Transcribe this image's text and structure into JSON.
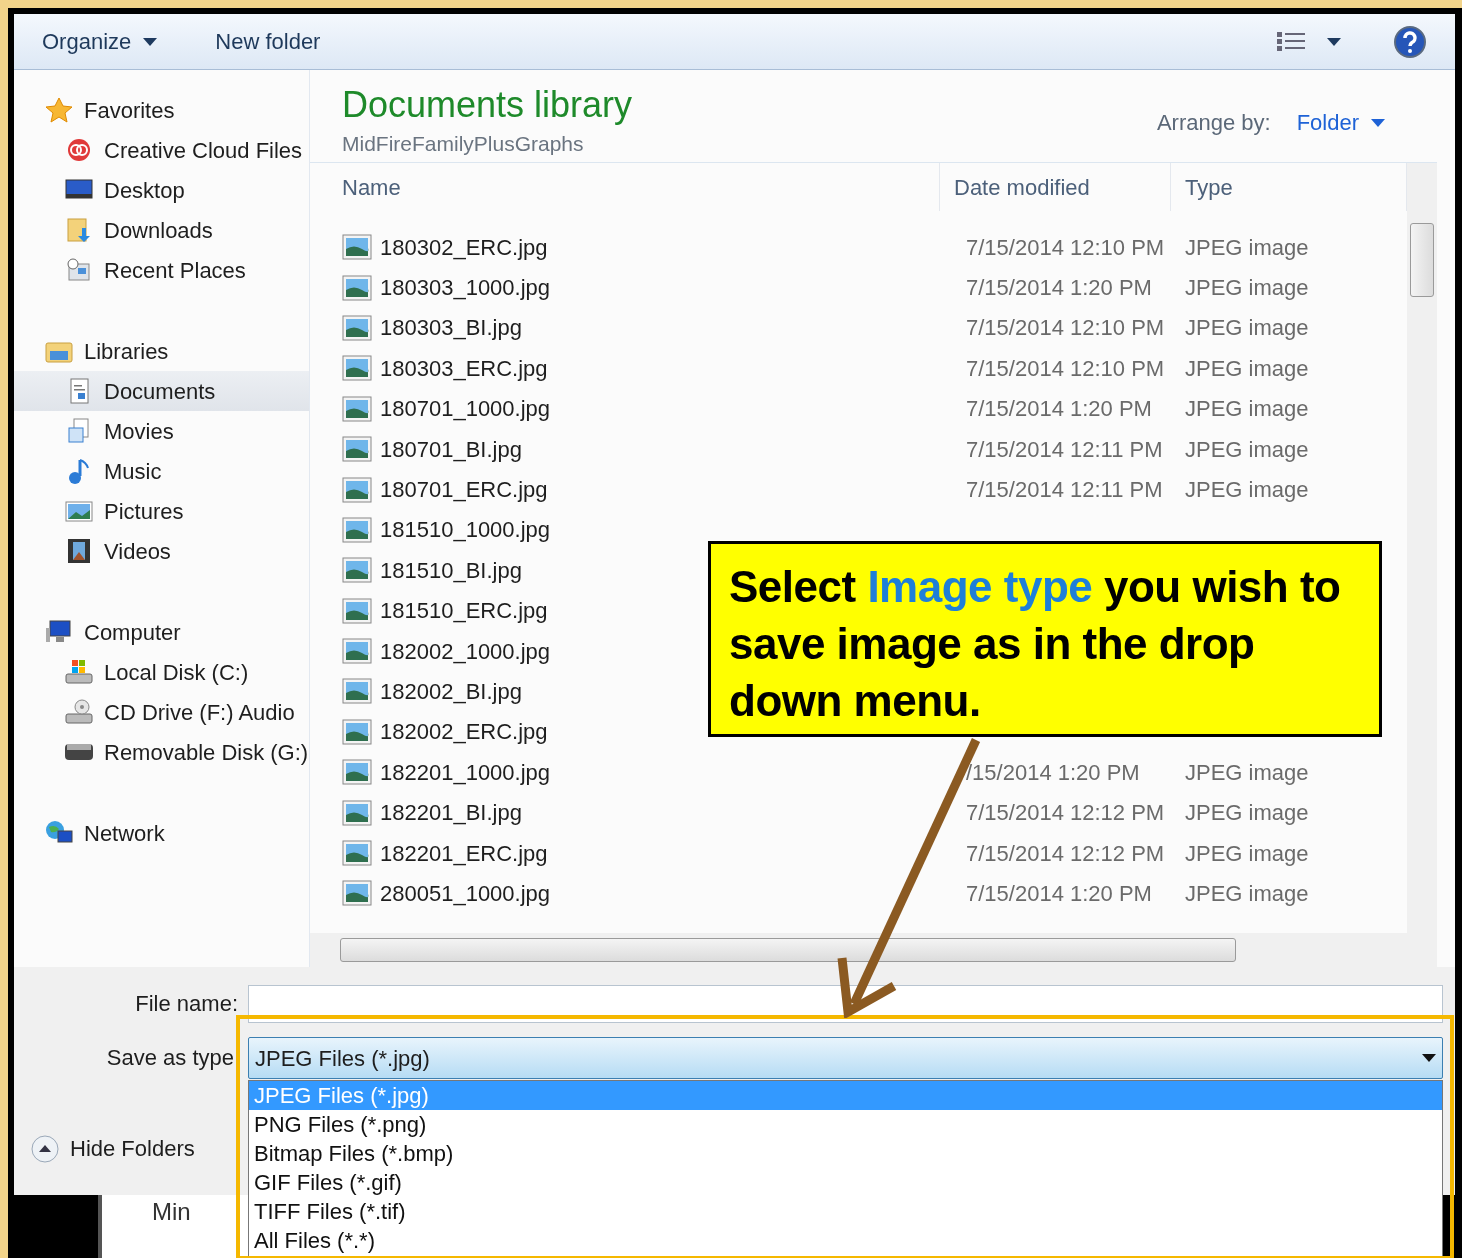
{
  "toolbar": {
    "organize": "Organize",
    "new_folder": "New folder"
  },
  "nav": [
    {
      "label": "Favorites",
      "children": [
        {
          "label": "Creative Cloud Files",
          "selected": false
        },
        {
          "label": "Desktop",
          "selected": false
        },
        {
          "label": "Downloads",
          "selected": false
        },
        {
          "label": "Recent Places",
          "selected": false
        }
      ]
    },
    {
      "label": "Libraries",
      "children": [
        {
          "label": "Documents",
          "selected": true
        },
        {
          "label": "Movies",
          "selected": false
        },
        {
          "label": "Music",
          "selected": false
        },
        {
          "label": "Pictures",
          "selected": false
        },
        {
          "label": "Videos",
          "selected": false
        }
      ]
    },
    {
      "label": "Computer",
      "children": [
        {
          "label": "Local Disk (C:)",
          "selected": false
        },
        {
          "label": "CD Drive (F:) Audio",
          "selected": false
        },
        {
          "label": "Removable Disk (G:)",
          "selected": false
        }
      ]
    },
    {
      "label": "Network"
    }
  ],
  "library": {
    "title": "Documents library",
    "subtitle": "MidFireFamilyPlusGraphs",
    "arrange_label": "Arrange by:",
    "arrange_value": "Folder"
  },
  "columns": [
    "Name",
    "Date modified",
    "Type"
  ],
  "rows": [
    {
      "name": "180302_ERC.jpg",
      "date": "7/15/2014 12:10 PM",
      "type": "JPEG image"
    },
    {
      "name": "180303_1000.jpg",
      "date": "7/15/2014 1:20 PM",
      "type": "JPEG image"
    },
    {
      "name": "180303_BI.jpg",
      "date": "7/15/2014 12:10 PM",
      "type": "JPEG image"
    },
    {
      "name": "180303_ERC.jpg",
      "date": "7/15/2014 12:10 PM",
      "type": "JPEG image"
    },
    {
      "name": "180701_1000.jpg",
      "date": "7/15/2014 1:20 PM",
      "type": "JPEG image"
    },
    {
      "name": "180701_BI.jpg",
      "date": "7/15/2014 12:11 PM",
      "type": "JPEG image"
    },
    {
      "name": "180701_ERC.jpg",
      "date": "7/15/2014 12:11 PM",
      "type": "JPEG image"
    },
    {
      "name": "181510_1000.jpg"
    },
    {
      "name": "181510_BI.jpg"
    },
    {
      "name": "181510_ERC.jpg"
    },
    {
      "name": "182002_1000.jpg"
    },
    {
      "name": "182002_BI.jpg"
    },
    {
      "name": "182002_ERC.jpg"
    },
    {
      "name": "182201_1000.jpg",
      "date": "/15/2014 1:20 PM",
      "type": "JPEG image"
    },
    {
      "name": "182201_BI.jpg",
      "date": "7/15/2014 12:12 PM",
      "type": "JPEG image"
    },
    {
      "name": "182201_ERC.jpg",
      "date": "7/15/2014 12:12 PM",
      "type": "JPEG image"
    },
    {
      "name": "280051_1000.jpg",
      "date": "7/15/2014 1:20 PM",
      "type": "JPEG image"
    }
  ],
  "file_name": {
    "label": "File name:"
  },
  "save_type": {
    "label": "Save as type",
    "value": "JPEG Files (*.jpg)",
    "options": [
      {
        "label": "JPEG Files (*.jpg)",
        "selected": true
      },
      {
        "label": "PNG Files (*.png)",
        "selected": false
      },
      {
        "label": "Bitmap Files (*.bmp)",
        "selected": false
      },
      {
        "label": "GIF Files (*.gif)",
        "selected": false
      },
      {
        "label": "TIFF Files (*.tif)",
        "selected": false
      },
      {
        "label": "All Files (*.*)",
        "selected": false
      }
    ]
  },
  "hide_folders": "Hide Folders",
  "callout": {
    "before": "Select ",
    "highlight": "Image type",
    "after": " you wish to save image as in the drop down menu."
  },
  "background_text": "Min"
}
